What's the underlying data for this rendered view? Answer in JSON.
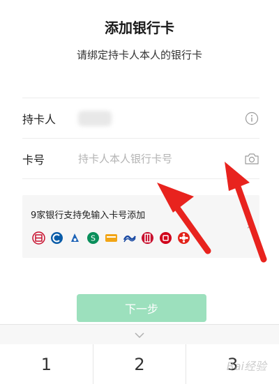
{
  "header": {
    "title": "添加银行卡",
    "subtitle": "请绑定持卡人本人的银行卡"
  },
  "form": {
    "cardholder_label": "持卡人",
    "card_number_label": "卡号",
    "card_number_placeholder": "持卡人本人银行卡号"
  },
  "banks": {
    "text": "9家银行支持免输入卡号添加",
    "logos": [
      "bank-logo-1",
      "bank-logo-2",
      "bank-logo-3",
      "bank-logo-4",
      "bank-logo-5",
      "bank-logo-6",
      "bank-logo-7",
      "bank-logo-8",
      "bank-logo-9"
    ]
  },
  "next_button": {
    "label": "下一步",
    "color": "#9ce0bd"
  },
  "keyboard": {
    "keys": [
      "1",
      "2",
      "3"
    ]
  },
  "colors": {
    "accent": "#07c160",
    "arrow": "#e8231e"
  },
  "watermark": "Bai经验"
}
